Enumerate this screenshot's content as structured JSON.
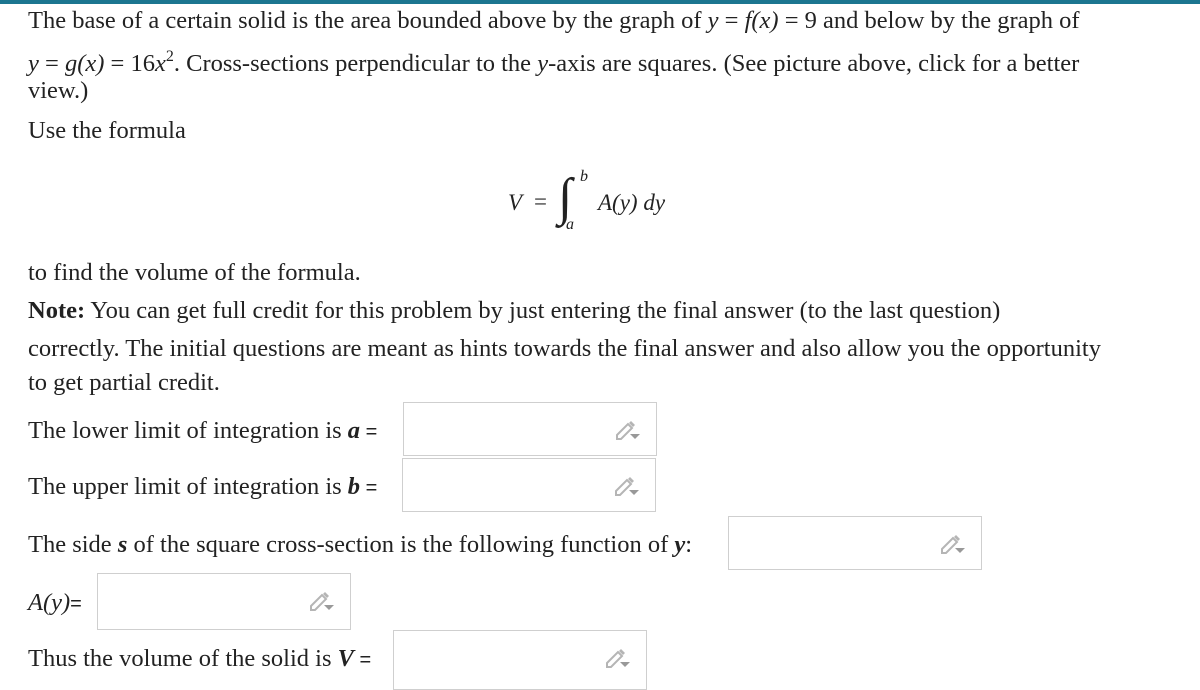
{
  "header": {
    "accent_color": "#1c7690"
  },
  "problem": {
    "line1_a": "The base of a certain solid is the area bounded above by the graph of ",
    "line1_m1": "y",
    "line1_eq1": " = ",
    "line1_m2": "f",
    "line1_m3": "(x)",
    "line1_eq2": " = 9",
    "line1_b": " and below by the graph of",
    "line2_m1": "y",
    "line2_eq": " = ",
    "line2_m2": "g",
    "line2_m3": "(x)",
    "line2_eq2": " = 16",
    "line2_m4": "x",
    "line2_sup": "2",
    "line2_b": ". Cross-sections perpendicular to the ",
    "line2_m5": "y",
    "line2_c": "-axis are squares. (See picture above, click for a better",
    "line3": "view.)",
    "use_formula": "Use the formula",
    "formula": {
      "V": "V",
      "eq": "=",
      "integral": "∫",
      "upper": "b",
      "lower": "a",
      "body": "A(y) dy"
    },
    "to_find": "to find the volume of the formula.",
    "note_label": "Note:",
    "note_line1": " You can get full credit for this problem by just entering the final answer (to the last question)",
    "note_line2": "correctly. The initial questions are meant as hints towards the final answer and also allow you the opportunity",
    "note_line3": "to get partial credit."
  },
  "questions": [
    {
      "text": "The lower limit of integration is ",
      "var": "a",
      "eq": " =",
      "value": "",
      "icon": "pencil-dropdown-icon"
    },
    {
      "text": "The upper limit of integration is ",
      "var": "b",
      "eq": " =",
      "value": "",
      "icon": "pencil-dropdown-icon"
    },
    {
      "text_a": "The side ",
      "var": "s",
      "text_b": " of the square cross-section is the following function of ",
      "var2": "y",
      "colon": ":",
      "value": "",
      "icon": "pencil-dropdown-icon"
    },
    {
      "var": "A(y)",
      "eq": "=",
      "value": "",
      "icon": "pencil-dropdown-icon"
    },
    {
      "text": "Thus the volume of the solid is ",
      "var": "V",
      "eq": " =",
      "value": "",
      "icon": "pencil-dropdown-icon"
    }
  ]
}
